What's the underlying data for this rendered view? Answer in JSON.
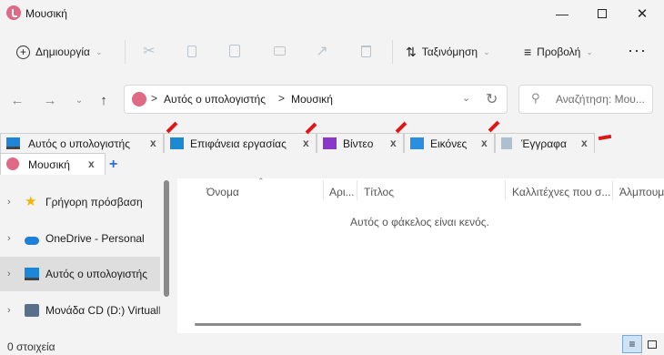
{
  "window": {
    "title": "Μουσική",
    "icons": {
      "app": "music-folder-icon",
      "minimize": "minimize-icon",
      "maximize": "maximize-icon",
      "close": "close-icon"
    }
  },
  "toolbar": {
    "new_label": "Δημιουργία",
    "sort_label": "Ταξινόμηση",
    "view_label": "Προβολή",
    "more_label": "···",
    "icons": [
      "add-circle-icon",
      "cut-icon",
      "copy-icon",
      "paste-icon",
      "rename-icon",
      "share-icon",
      "delete-icon",
      "sort-icon",
      "view-icon"
    ]
  },
  "nav": {
    "breadcrumb": [
      "Αυτός ο υπολογιστής",
      "Μουσική"
    ],
    "separator": ">",
    "search_placeholder": "Αναζήτηση: Μου..."
  },
  "tabs": [
    {
      "label": "Αυτός ο υπολογιστής",
      "close": "x",
      "icon": "computer-icon"
    },
    {
      "label": "Επιφάνεια εργασίας",
      "close": "x",
      "icon": "desktop-icon"
    },
    {
      "label": "Βίντεο",
      "close": "x",
      "icon": "video-icon"
    },
    {
      "label": "Εικόνες",
      "close": "x",
      "icon": "pictures-icon"
    },
    {
      "label": "Έγγραφα",
      "close": "x",
      "icon": "documents-icon"
    },
    {
      "label": "Μουσική",
      "close": "x",
      "icon": "music-icon",
      "active": true
    }
  ],
  "new_tab_label": "+",
  "sidebar": {
    "items": [
      {
        "label": "Γρήγορη πρόσβαση",
        "icon": "star-icon"
      },
      {
        "label": "OneDrive - Personal",
        "icon": "cloud-icon"
      },
      {
        "label": "Αυτός ο υπολογιστής",
        "icon": "computer-icon",
        "selected": true
      },
      {
        "label": "Μονάδα CD (D:) VirtualBox",
        "icon": "cd-drive-icon"
      }
    ]
  },
  "list": {
    "columns": [
      "Όνομα",
      "Αρι...",
      "Τίτλος",
      "Καλλιτέχνες που σ...",
      "Άλμπουμ"
    ],
    "empty_message": "Αυτός ο φάκελος είναι κενός."
  },
  "status": {
    "items_text": "0 στοιχεία"
  },
  "colors": {
    "accent": "#2b6cd1",
    "annotation_arrow": "#e01616",
    "selected_bg": "#dedede"
  }
}
